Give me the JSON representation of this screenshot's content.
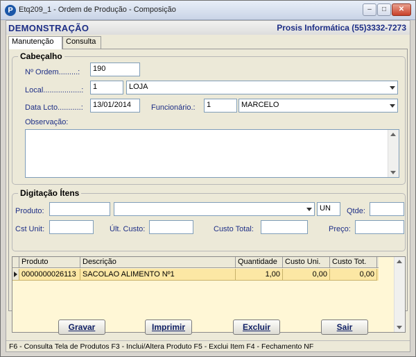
{
  "window": {
    "title": "Etq209_1 - Ordem de Produção - Composição",
    "icon_letter": "P",
    "min_label": "–",
    "max_label": "□",
    "close_label": "✕"
  },
  "header": {
    "company": "DEMONSTRAÇÃO",
    "vendor": "Prosis Informática (55)3332-7273"
  },
  "tabs": [
    {
      "label": "Manutenção"
    },
    {
      "label": "Consulta"
    }
  ],
  "cabecalho": {
    "title": "Cabeçalho",
    "ordem_label": "Nº Ordem.........:",
    "ordem_value": "190",
    "local_label": "Local..................:",
    "local_code": "1",
    "local_name": "LOJA",
    "data_label": "Data Lcto...........:",
    "data_value": "13/01/2014",
    "funcionario_label": "Funcionário.:",
    "funcionario_code": "1",
    "funcionario_name": "MARCELO",
    "observacao_label": "Observação:"
  },
  "digitacao": {
    "title": "Digitação Ítens",
    "produto_label": "Produto:",
    "unit_value": "UN",
    "qtde_label": "Qtde:",
    "cst_unit_label": "Cst Unit:",
    "ult_custo_label": "Últ. Custo:",
    "custo_total_label": "Custo Total:",
    "preco_label": "Preço:"
  },
  "grid": {
    "columns": [
      "Produto",
      "Descrição",
      "Quantidade",
      "Custo Uni.",
      "Custo Tot."
    ],
    "rows": [
      {
        "produto": "0000000026113",
        "descricao": "SACOLAO ALIMENTO Nº1",
        "quantidade": "1,00",
        "custo_uni": "0,00",
        "custo_tot": "0,00"
      }
    ]
  },
  "buttons": {
    "gravar": "Gravar",
    "imprimir": "Imprimir",
    "excluir": "Excluir",
    "sair": "Sair"
  },
  "status": {
    "text": "F6 - Consulta Tela de Produtos  F3 - Inclui/Altera Produto  F5 - Exclui Item  F4 - Fechamento NF"
  }
}
